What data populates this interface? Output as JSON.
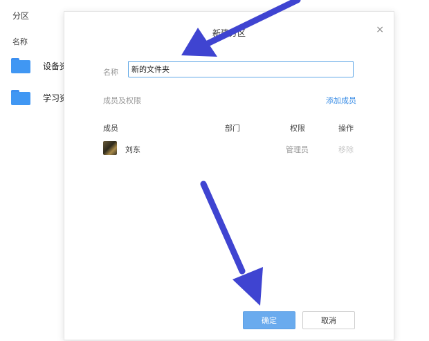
{
  "background": {
    "section_title": "分区",
    "column_header": "名称",
    "items": [
      {
        "label": "设备资",
        "icon": "folder-icon"
      },
      {
        "label": "学习资",
        "icon": "folder-icon"
      }
    ]
  },
  "dialog": {
    "title": "新建分区",
    "name_label": "名称",
    "name_value": "新的文件夹",
    "members_label": "成员及权限",
    "add_member": "添加成员",
    "table_headers": {
      "member": "成员",
      "department": "部门",
      "permission": "权限",
      "action": "操作"
    },
    "rows": [
      {
        "name": "刘东",
        "department": "",
        "permission": "管理员",
        "action": "移除"
      }
    ],
    "ok_label": "确定",
    "cancel_label": "取消"
  },
  "colors": {
    "accent": "#3b8ee6",
    "arrow": "#3f44d1",
    "folder": "#4097f3"
  }
}
